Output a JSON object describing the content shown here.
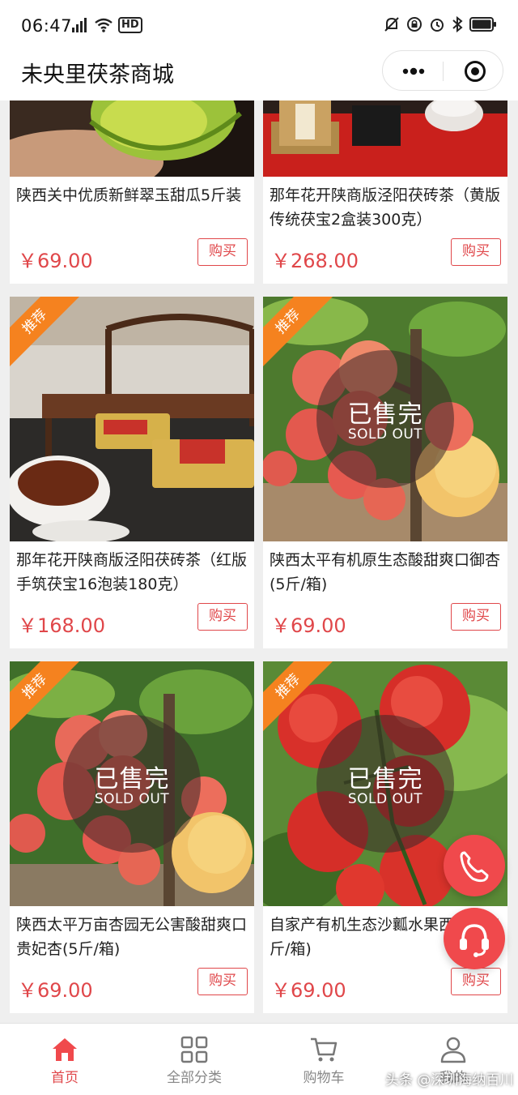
{
  "status_bar": {
    "time": "06:47",
    "signal_text": "4G",
    "hd_text": "HD"
  },
  "app": {
    "title": "未央里茯茶商城"
  },
  "products": [
    {
      "name": "陕西关中优质新鲜翠玉甜瓜5斤装",
      "price": "￥69.00",
      "buy_label": "购买"
    },
    {
      "name": "那年花开陕商版泾阳茯砖茶（黄版传统茯宝2盒装300克）",
      "price": "￥268.00",
      "buy_label": "购买"
    },
    {
      "name": "那年花开陕商版泾阳茯砖茶（红版手筑茯宝16泡装180克）",
      "price": "￥168.00",
      "buy_label": "购买",
      "badge": "推荐"
    },
    {
      "name": "陕西太平有机原生态酸甜爽口御杏(5斤/箱)",
      "price": "￥69.00",
      "buy_label": "购买",
      "badge": "推荐",
      "sold_out_cn": "已售完",
      "sold_out_en": "SOLD OUT"
    },
    {
      "name": "陕西太平万亩杏园无公害酸甜爽口贵妃杏(5斤/箱)",
      "price": "￥69.00",
      "buy_label": "购买",
      "badge": "推荐",
      "sold_out_cn": "已售完",
      "sold_out_en": "SOLD OUT"
    },
    {
      "name": "自家产有机生态沙瓤水果西红柿(5斤/箱)",
      "price": "￥69.00",
      "buy_label": "购买",
      "badge": "推荐",
      "sold_out_cn": "已售完",
      "sold_out_en": "SOLD OUT"
    }
  ],
  "tabs": [
    {
      "label": "首页",
      "icon": "home-icon",
      "active": true
    },
    {
      "label": "全部分类",
      "icon": "grid-icon",
      "active": false
    },
    {
      "label": "购物车",
      "icon": "cart-icon",
      "active": false
    },
    {
      "label": "我的",
      "icon": "user-icon",
      "active": false
    }
  ],
  "watermark": "头条 @深圳海纳百川",
  "colors": {
    "accent": "#e0474a",
    "badge": "#f5821f",
    "float_button": "#f0494c"
  }
}
